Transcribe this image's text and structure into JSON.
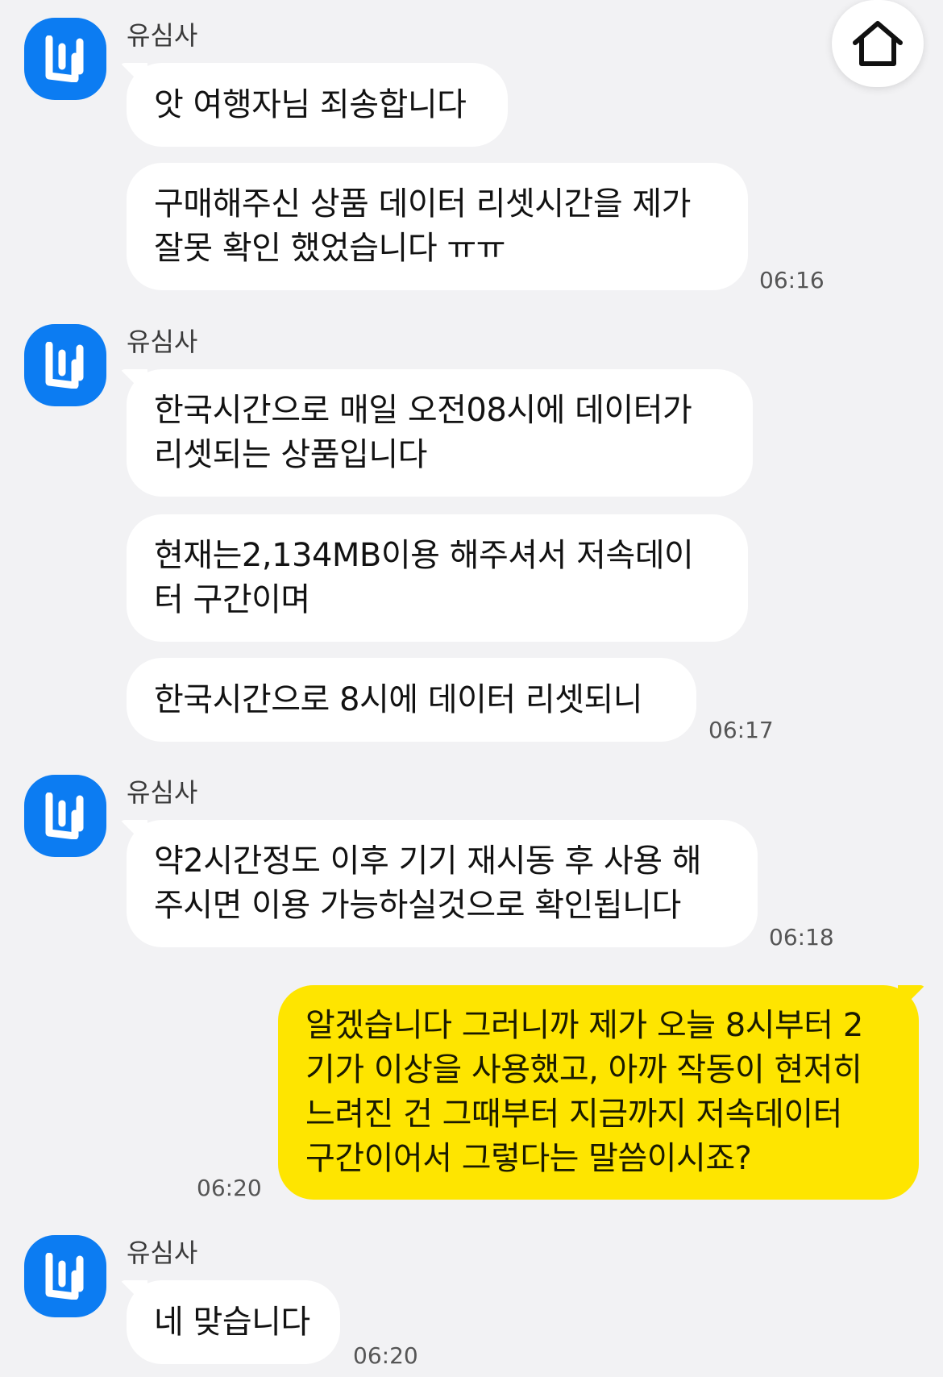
{
  "chat": {
    "sender_name": "유심사",
    "groups": [
      {
        "messages": [
          {
            "text": "앗 여행자님 죄송합니다",
            "time": ""
          },
          {
            "text": "구매해주신 상품 데이터 리셋시간을 제가\n잘못 확인 했었습니다 ㅠㅠ",
            "time": "06:16"
          }
        ]
      },
      {
        "messages": [
          {
            "text": "한국시간으로 매일 오전08시에 데이터가\n리셋되는 상품입니다",
            "time": ""
          },
          {
            "text": "현재는2,134MB이용 해주셔서 저속데이\n터 구간이며",
            "time": ""
          },
          {
            "text": "한국시간으로 8시에 데이터 리셋되니",
            "time": "06:17"
          }
        ]
      },
      {
        "messages": [
          {
            "text": "약2시간정도 이후 기기 재시동 후 사용 해\n주시면 이용 가능하실것으로 확인됩니다",
            "time": "06:18"
          }
        ]
      },
      {
        "messages": [
          {
            "text": "알겠습니다 그러니까 제가 오늘 8시부터 2\n기가 이상을 사용했고, 아까 작동이 현저히\n느려진 건 그때부터 지금까지 저속데이터\n구간이어서 그렇다는 말씀이시죠?",
            "time": "06:20"
          }
        ]
      },
      {
        "messages": [
          {
            "text": "네 맞습니다",
            "time": "06:20"
          }
        ]
      }
    ]
  },
  "home_button": {
    "icon": "home-icon"
  },
  "avatar": {
    "icon": "usimsa-logo-icon",
    "color": "#0c7cf2"
  },
  "colors": {
    "background": "#f2f2f4",
    "mine_bubble": "#fee500",
    "their_bubble": "#ffffff"
  }
}
